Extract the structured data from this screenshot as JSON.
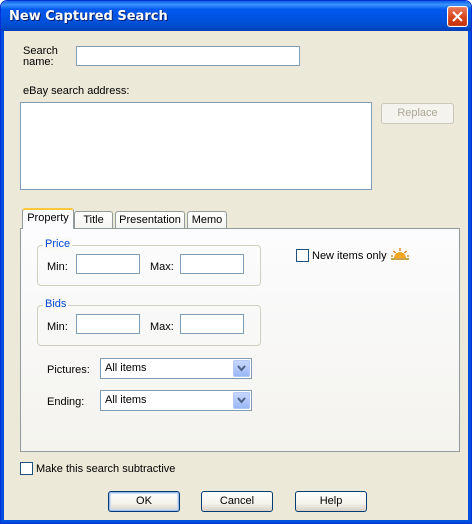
{
  "window": {
    "title": "New Captured Search"
  },
  "form": {
    "search_name_label": "Search\nname:",
    "search_name_value": "",
    "address_label": "eBay search address:",
    "address_value": "",
    "replace_label": "Replace"
  },
  "tabs": [
    {
      "label": "Property",
      "active": true
    },
    {
      "label": "Title",
      "active": false
    },
    {
      "label": "Presentation",
      "active": false
    },
    {
      "label": "Memo",
      "active": false
    }
  ],
  "property": {
    "price": {
      "title": "Price",
      "min_label": "Min:",
      "max_label": "Max:",
      "min_value": "",
      "max_value": ""
    },
    "bids": {
      "title": "Bids",
      "min_label": "Min:",
      "max_label": "Max:",
      "min_value": "",
      "max_value": ""
    },
    "new_items_only": {
      "label": "New items only",
      "checked": false,
      "icon": "sunrise-icon"
    },
    "pictures": {
      "label": "Pictures:",
      "value": "All items"
    },
    "ending": {
      "label": "Ending:",
      "value": "All items"
    }
  },
  "subtractive": {
    "label": "Make this search subtractive",
    "checked": false
  },
  "buttons": {
    "ok": "OK",
    "cancel": "Cancel",
    "help": "Help"
  },
  "colors": {
    "titlebar": "#0054E3",
    "face": "#ECE9D8",
    "group_title": "#0046D5"
  }
}
